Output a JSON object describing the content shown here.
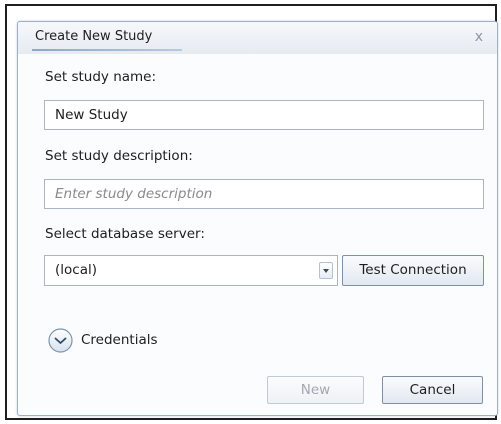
{
  "dialog": {
    "title": "Create New Study",
    "close_glyph": "x"
  },
  "study_name": {
    "label": "Set study name:",
    "value": "New Study"
  },
  "study_description": {
    "label": "Set study description:",
    "placeholder": "Enter study description",
    "value": ""
  },
  "database_server": {
    "label": "Select database server:",
    "selected": "(local)",
    "test_button_label": "Test Connection"
  },
  "credentials": {
    "label": "Credentials",
    "expander_icon": "chevron-down-circle-icon"
  },
  "footer": {
    "new_label": "New",
    "cancel_label": "Cancel"
  },
  "colors": {
    "accent": "#8ea7c7",
    "border": "#aab6c6",
    "disabled_text": "#a2a8b0"
  }
}
